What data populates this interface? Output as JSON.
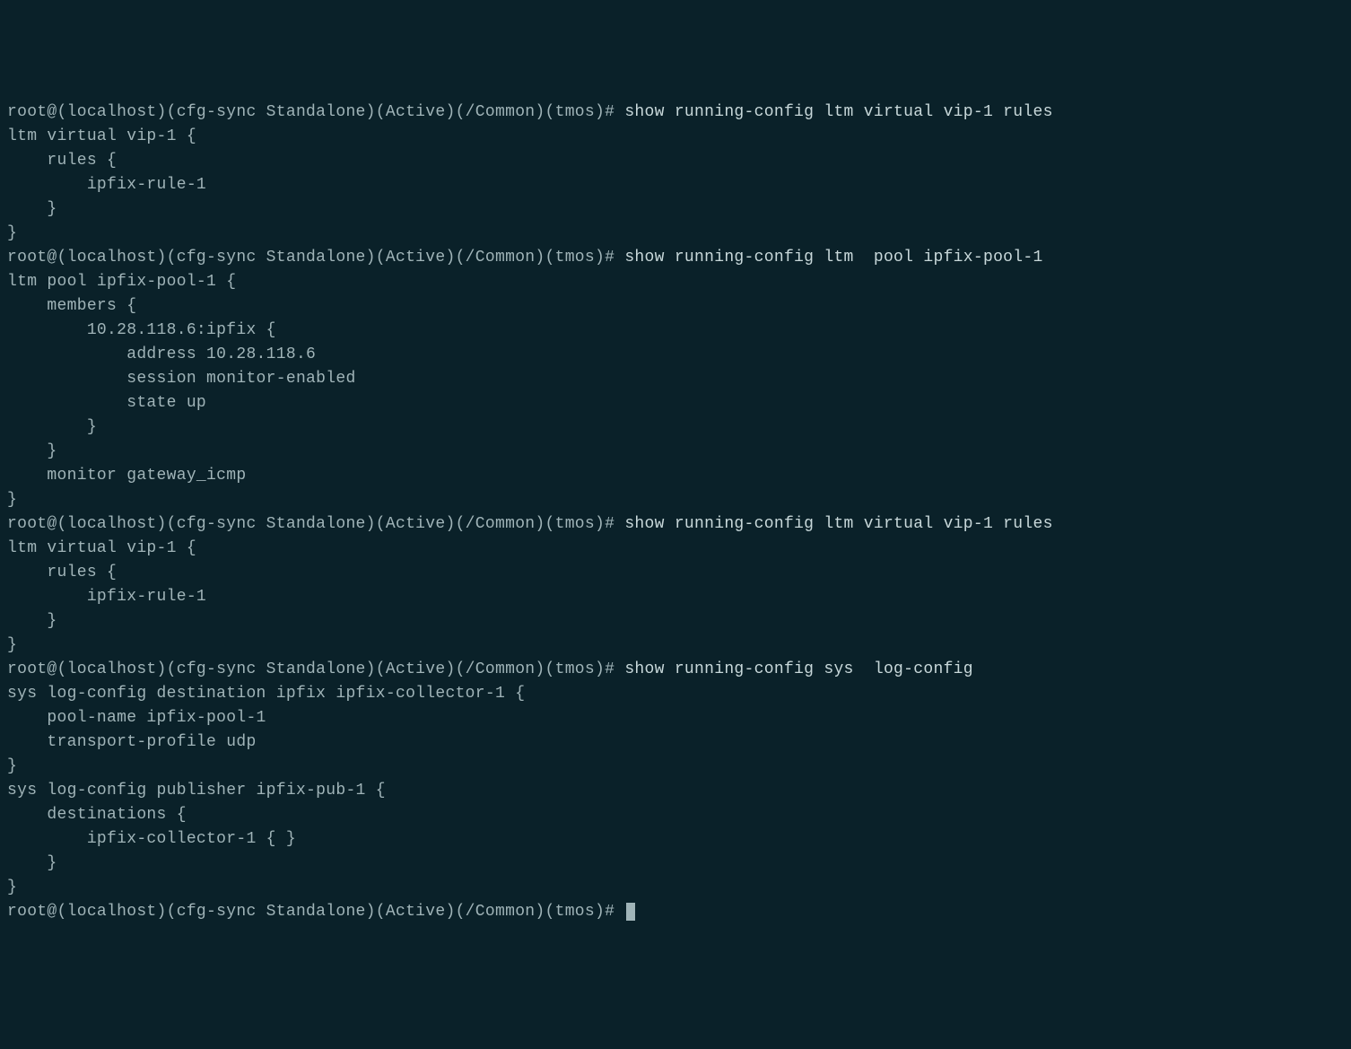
{
  "prompt": "root@(localhost)(cfg-sync Standalone)(Active)(/Common)(tmos)# ",
  "lines": [
    {
      "type": "prompt",
      "cmd": "show running-config ltm virtual vip-1 rules"
    },
    {
      "type": "output",
      "text": "ltm virtual vip-1 {"
    },
    {
      "type": "output",
      "text": "    rules {"
    },
    {
      "type": "output",
      "text": "        ipfix-rule-1"
    },
    {
      "type": "output",
      "text": "    }"
    },
    {
      "type": "output",
      "text": "}"
    },
    {
      "type": "prompt",
      "cmd": "show running-config ltm  pool ipfix-pool-1"
    },
    {
      "type": "output",
      "text": "ltm pool ipfix-pool-1 {"
    },
    {
      "type": "output",
      "text": "    members {"
    },
    {
      "type": "output",
      "text": "        10.28.118.6:ipfix {"
    },
    {
      "type": "output",
      "text": "            address 10.28.118.6"
    },
    {
      "type": "output",
      "text": "            session monitor-enabled"
    },
    {
      "type": "output",
      "text": "            state up"
    },
    {
      "type": "output",
      "text": "        }"
    },
    {
      "type": "output",
      "text": "    }"
    },
    {
      "type": "output",
      "text": "    monitor gateway_icmp"
    },
    {
      "type": "output",
      "text": "}"
    },
    {
      "type": "prompt",
      "cmd": "show running-config ltm virtual vip-1 rules"
    },
    {
      "type": "output",
      "text": "ltm virtual vip-1 {"
    },
    {
      "type": "output",
      "text": "    rules {"
    },
    {
      "type": "output",
      "text": "        ipfix-rule-1"
    },
    {
      "type": "output",
      "text": "    }"
    },
    {
      "type": "output",
      "text": "}"
    },
    {
      "type": "prompt",
      "cmd": "show running-config sys  log-config"
    },
    {
      "type": "output",
      "text": "sys log-config destination ipfix ipfix-collector-1 {"
    },
    {
      "type": "output",
      "text": "    pool-name ipfix-pool-1"
    },
    {
      "type": "output",
      "text": "    transport-profile udp"
    },
    {
      "type": "output",
      "text": "}"
    },
    {
      "type": "output",
      "text": "sys log-config publisher ipfix-pub-1 {"
    },
    {
      "type": "output",
      "text": "    destinations {"
    },
    {
      "type": "output",
      "text": "        ipfix-collector-1 { }"
    },
    {
      "type": "output",
      "text": "    }"
    },
    {
      "type": "output",
      "text": "}"
    },
    {
      "type": "prompt-cursor",
      "cmd": ""
    }
  ]
}
